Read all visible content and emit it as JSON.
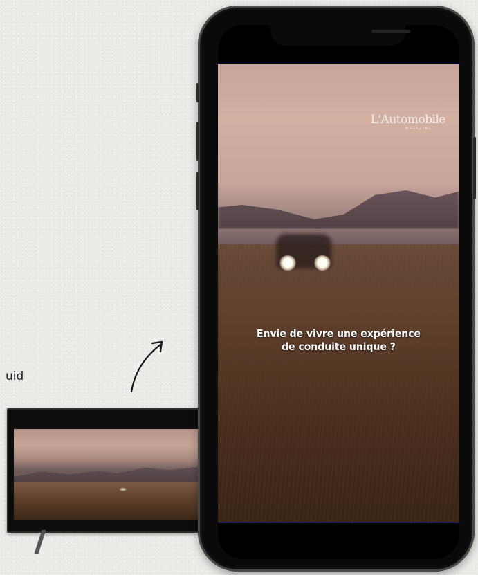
{
  "side_label": "uid",
  "video": {
    "brand_name": "L'Automobile",
    "brand_subtitle": "MAGAZINE",
    "caption_line1": "Envie de vivre une expérience",
    "caption_line2": "de conduite unique ?"
  },
  "icons": [
    "curved-arrow-icon"
  ],
  "colors": {
    "background": "#ecebe8",
    "phone_frame": "#0a0a0a",
    "caption_text": "#ffffff"
  }
}
